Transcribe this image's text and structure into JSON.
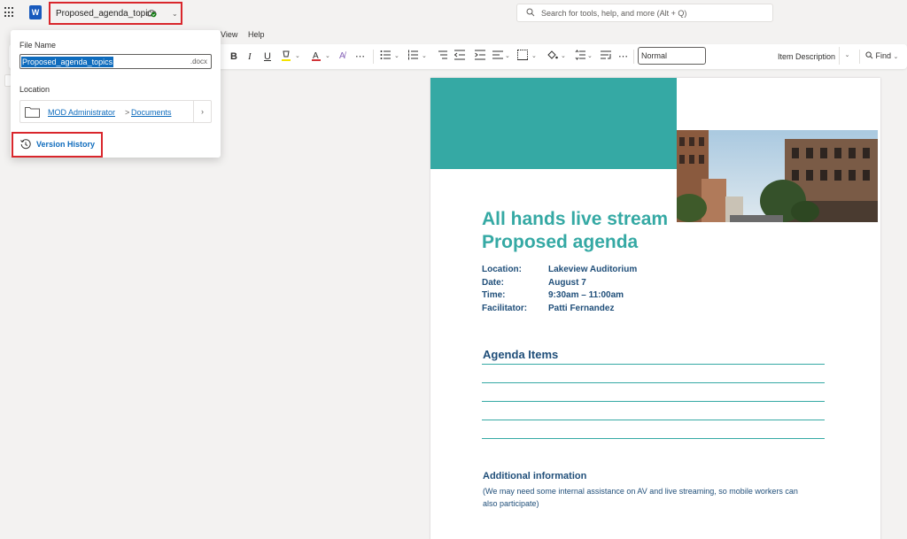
{
  "titlebar": {
    "filename": "Proposed_agenda_topics",
    "search_placeholder": "Search for tools, help, and more (Alt + Q)"
  },
  "menu": {
    "view": "View",
    "help": "Help"
  },
  "ribbon": {
    "style_name": "Normal",
    "style_gallery_item": "Item Description",
    "find_label": "Find",
    "bold": "B",
    "italic": "I",
    "underline": "U"
  },
  "flyout": {
    "file_name_label": "File Name",
    "file_name_value": "Proposed_agenda_topics",
    "extension": ".docx",
    "location_label": "Location",
    "location_owner": "MOD Administrator",
    "location_separator": ">",
    "location_folder": "Documents",
    "version_history": "Version History"
  },
  "document": {
    "title_line1": "All hands live stream",
    "title_line2": "Proposed agenda",
    "details": [
      {
        "key": "Location:",
        "value": "Lakeview Auditorium"
      },
      {
        "key": "Date:",
        "value": "August 7"
      },
      {
        "key": "Time:",
        "value": "9:30am – 11:00am"
      },
      {
        "key": "Facilitator:",
        "value": "Patti Fernandez"
      }
    ],
    "agenda_heading": "Agenda Items",
    "additional_heading": "Additional information",
    "additional_text": "(We may need some internal assistance on AV and live streaming, so mobile workers can also participate)"
  },
  "colors": {
    "accent_teal": "#35a9a4",
    "text_navy": "#1f4e79",
    "highlight_red": "#d9262c",
    "link_blue": "#0f6cbd"
  }
}
